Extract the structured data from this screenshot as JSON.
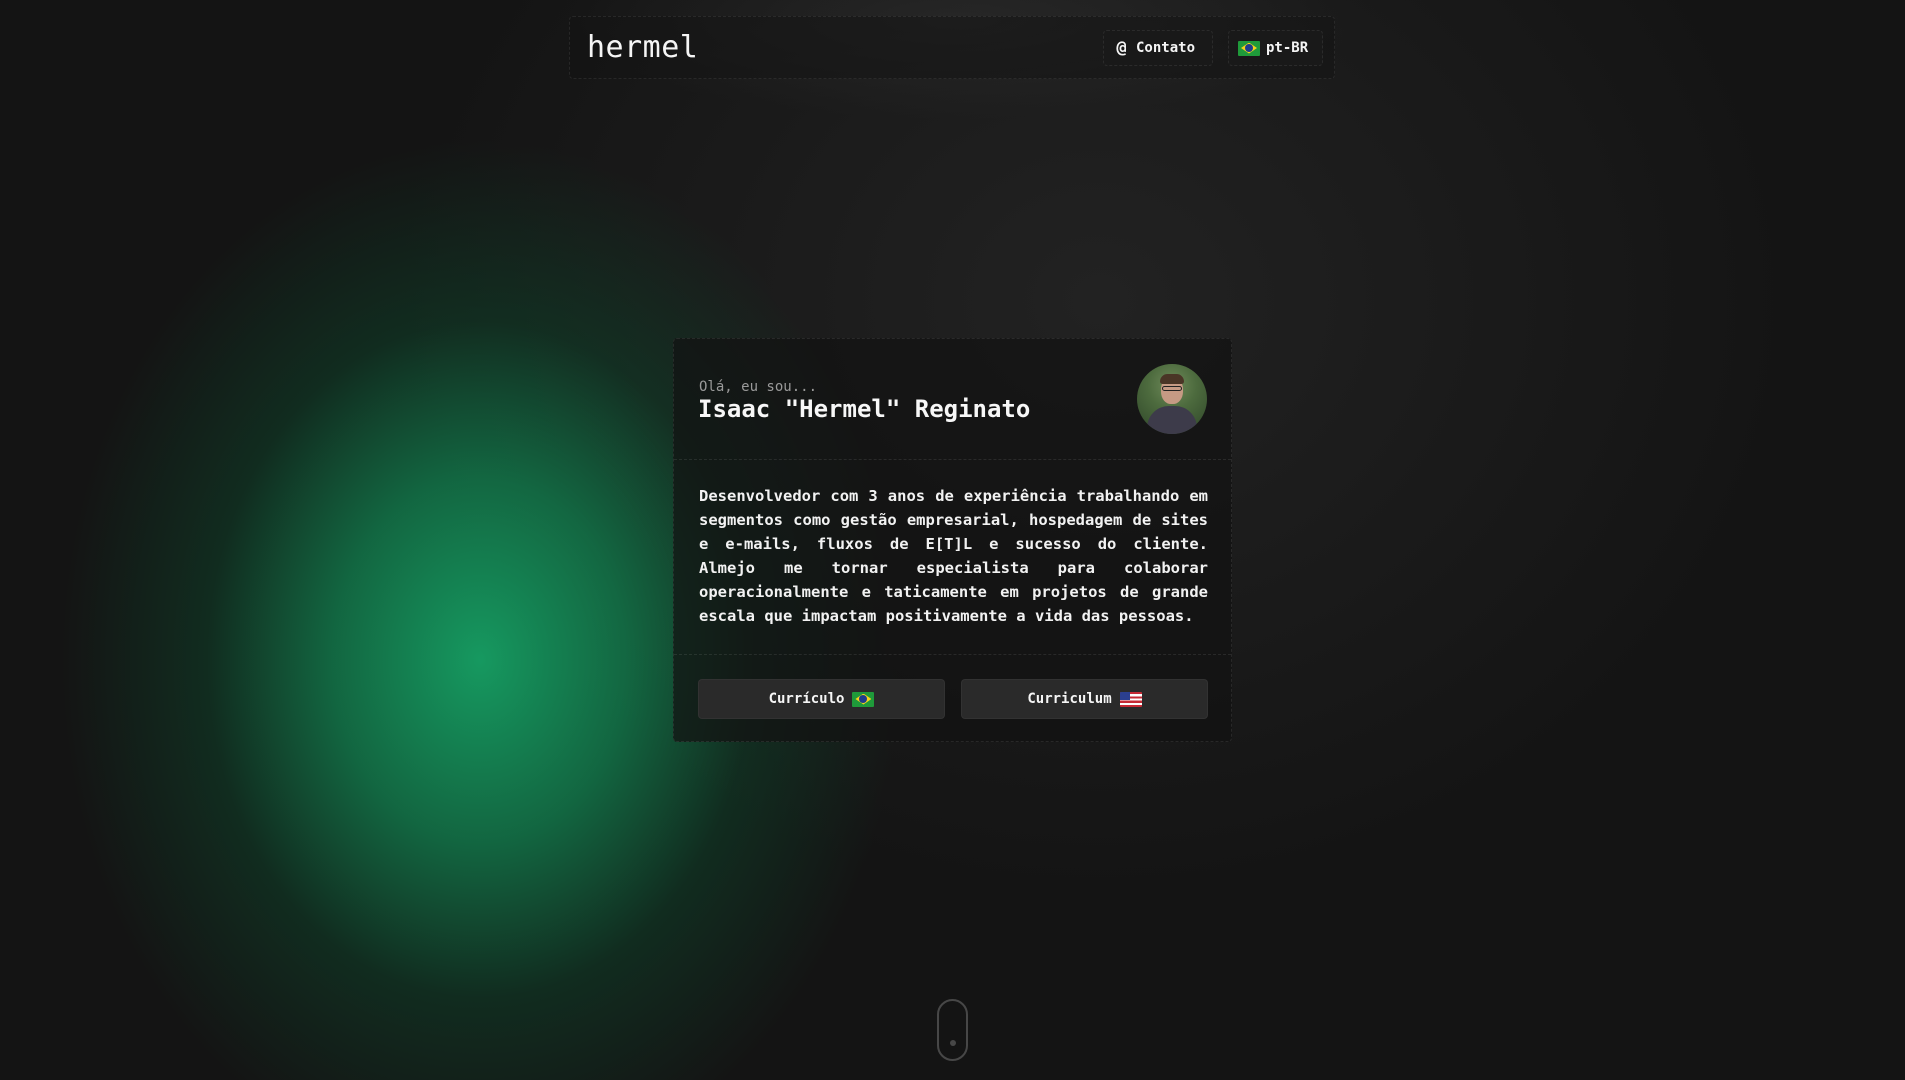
{
  "navbar": {
    "logo": "hermel",
    "contact_label": "Contato",
    "contact_icon": "at-icon",
    "language_label": "pt-BR",
    "language_icon": "flag-br-icon"
  },
  "hero": {
    "greeting": "Olá, eu sou...",
    "name": "Isaac \"Hermel\" Reginato",
    "bio": "Desenvolvedor com 3 anos de experiência trabalhando em segmentos como gestão empresarial, hospedagem de sites e e-mails, fluxos de E[T]L e sucesso do cliente. Almejo me tornar especialista para colaborar operacionalmente e taticamente em projetos de grande escala que impactam positivamente a vida das pessoas.",
    "buttons": [
      {
        "label": "Currículo",
        "icon": "flag-br-icon"
      },
      {
        "label": "Curriculum",
        "icon": "flag-us-icon"
      }
    ]
  },
  "colors": {
    "background": "#141414",
    "accent_glow": "#16a064",
    "button_bg": "#2a2a2a",
    "text": "#f2f2f2",
    "muted_text": "#9a9a9a"
  }
}
